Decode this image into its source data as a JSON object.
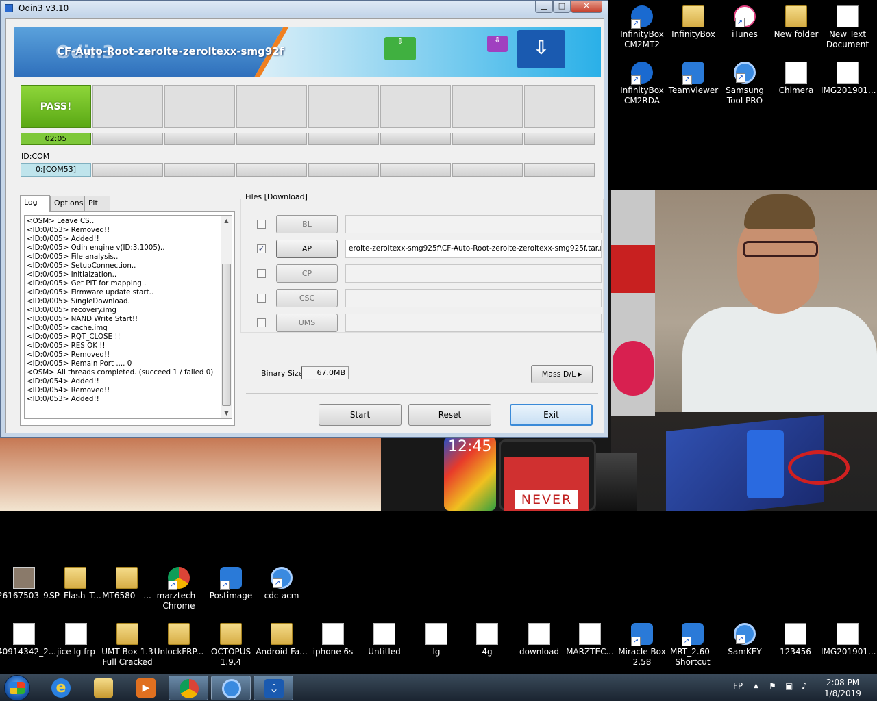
{
  "odin": {
    "title": "Odin3 v3.10",
    "window_buttons": {
      "minimize": "▁",
      "maximize": "□",
      "close": "✕"
    },
    "banner": {
      "logo": "Odin3",
      "message": "CF-Auto-Root-zerolte-zeroltexx-smg92f"
    },
    "ports": {
      "pass_label": "PASS!",
      "elapsed": "02:05",
      "id_com_label": "ID:COM",
      "com_port": "0:[COM53]"
    },
    "tabs": [
      {
        "label": "Log"
      },
      {
        "label": "Options"
      },
      {
        "label": "Pit"
      }
    ],
    "log_lines": [
      "<OSM> Leave CS..",
      "<ID:0/053> Removed!!",
      "<ID:0/005> Added!!",
      "<ID:0/005> Odin engine v(ID:3.1005)..",
      "<ID:0/005> File analysis..",
      "<ID:0/005> SetupConnection..",
      "<ID:0/005> Initialzation..",
      "<ID:0/005> Get PIT for mapping..",
      "<ID:0/005> Firmware update start..",
      "<ID:0/005> SingleDownload.",
      "<ID:0/005> recovery.img",
      "<ID:0/005> NAND Write Start!!",
      "<ID:0/005> cache.img",
      "<ID:0/005> RQT_CLOSE !!",
      "<ID:0/005> RES OK !!",
      "<ID:0/005> Removed!!",
      "<ID:0/005> Remain Port ....  0",
      "<OSM> All threads completed. (succeed 1 / failed 0)",
      "<ID:0/054> Added!!",
      "<ID:0/054> Removed!!",
      "<ID:0/053> Added!!"
    ],
    "files": {
      "group_label": "Files [Download]",
      "rows": [
        {
          "button": "BL",
          "checked": false,
          "path": ""
        },
        {
          "button": "AP",
          "checked": true,
          "path": "erolte-zeroltexx-smg925f\\CF-Auto-Root-zerolte-zeroltexx-smg925f.tar.md5"
        },
        {
          "button": "CP",
          "checked": false,
          "path": ""
        },
        {
          "button": "CSC",
          "checked": false,
          "path": ""
        },
        {
          "button": "UMS",
          "checked": false,
          "path": ""
        }
      ],
      "check_mark": "✓"
    },
    "binary_size_label": "Binary Size",
    "binary_size_value": "67.0MB",
    "mass_dl_label": "Mass D/L ▸",
    "buttons": {
      "start": "Start",
      "reset": "Reset",
      "exit": "Exit"
    }
  },
  "desktop": {
    "wallpaper_text": {
      "clock": "12:45",
      "never": "NEVER"
    },
    "icons_top": [
      {
        "label": "InfinityBox CM2MT2",
        "icon": "infinitybox-cm2mt2-icon"
      },
      {
        "label": "InfinityBox",
        "icon": "folder-icon"
      },
      {
        "label": "iTunes",
        "icon": "itunes-icon"
      },
      {
        "label": "New folder",
        "icon": "folder-icon"
      },
      {
        "label": "New Text Document",
        "icon": "text-document-icon"
      },
      {
        "label": "InfinityBox CM2RDA",
        "icon": "infinitybox-cm2rda-icon"
      },
      {
        "label": "TeamViewer",
        "icon": "teamviewer-icon"
      },
      {
        "label": "Samsung Tool PRO",
        "icon": "samsung-tool-pro-icon"
      },
      {
        "label": "Chimera",
        "icon": "chimera-icon"
      },
      {
        "label": "IMG201901...",
        "icon": "image-file-icon"
      }
    ],
    "icons_mid": [
      {
        "label": "26167503_9...",
        "icon": "photo-file-icon"
      },
      {
        "label": "SP_Flash_T...",
        "icon": "folder-icon"
      },
      {
        "label": "MT6580__...",
        "icon": "folder-icon"
      },
      {
        "label": "marztech - Chrome",
        "icon": "chrome-icon"
      },
      {
        "label": "Postimage",
        "icon": "postimage-icon"
      },
      {
        "label": "cdc-acm",
        "icon": "cdc-acm-icon"
      }
    ],
    "icons_bottom": [
      {
        "label": "40914342_2...",
        "icon": "image-file-icon"
      },
      {
        "label": "jice lg frp",
        "icon": "winrar-icon"
      },
      {
        "label": "UMT Box 1.3 Full Cracked",
        "icon": "folder-icon"
      },
      {
        "label": "UnlockFRP...",
        "icon": "folder-icon"
      },
      {
        "label": "OCTOPUS 1.9.4",
        "icon": "folder-icon"
      },
      {
        "label": "Android-Fa...",
        "icon": "folder-icon"
      },
      {
        "label": "iphone 6s",
        "icon": "image-file-icon"
      },
      {
        "label": "Untitled",
        "icon": "image-file-icon"
      },
      {
        "label": "lg",
        "icon": "image-file-icon"
      },
      {
        "label": "4g",
        "icon": "image-file-icon"
      },
      {
        "label": "download",
        "icon": "pdf-icon"
      },
      {
        "label": "MARZTEC...",
        "icon": "image-file-icon"
      },
      {
        "label": "Miracle Box 2.58",
        "icon": "miracle-box-icon"
      },
      {
        "label": "MRT_2.60 - Shortcut",
        "icon": "mrt-icon"
      },
      {
        "label": "SamKEY",
        "icon": "samkey-icon"
      },
      {
        "label": "123456",
        "icon": "text-document-icon"
      },
      {
        "label": "IMG201901...",
        "icon": "image-file-icon"
      }
    ]
  },
  "taskbar": {
    "items": [
      {
        "icon": "internet-explorer-icon"
      },
      {
        "icon": "file-explorer-icon"
      },
      {
        "icon": "media-player-icon"
      },
      {
        "icon": "chrome-icon"
      },
      {
        "icon": "samsung-tool-icon"
      },
      {
        "icon": "odin-icon"
      }
    ],
    "language": "FP",
    "time": "2:08 PM",
    "date": "1/8/2019"
  },
  "colors": {
    "pass_green": "#5aa814",
    "com_blue": "#bfe4ec",
    "focus_blue": "#3a8ad8"
  }
}
